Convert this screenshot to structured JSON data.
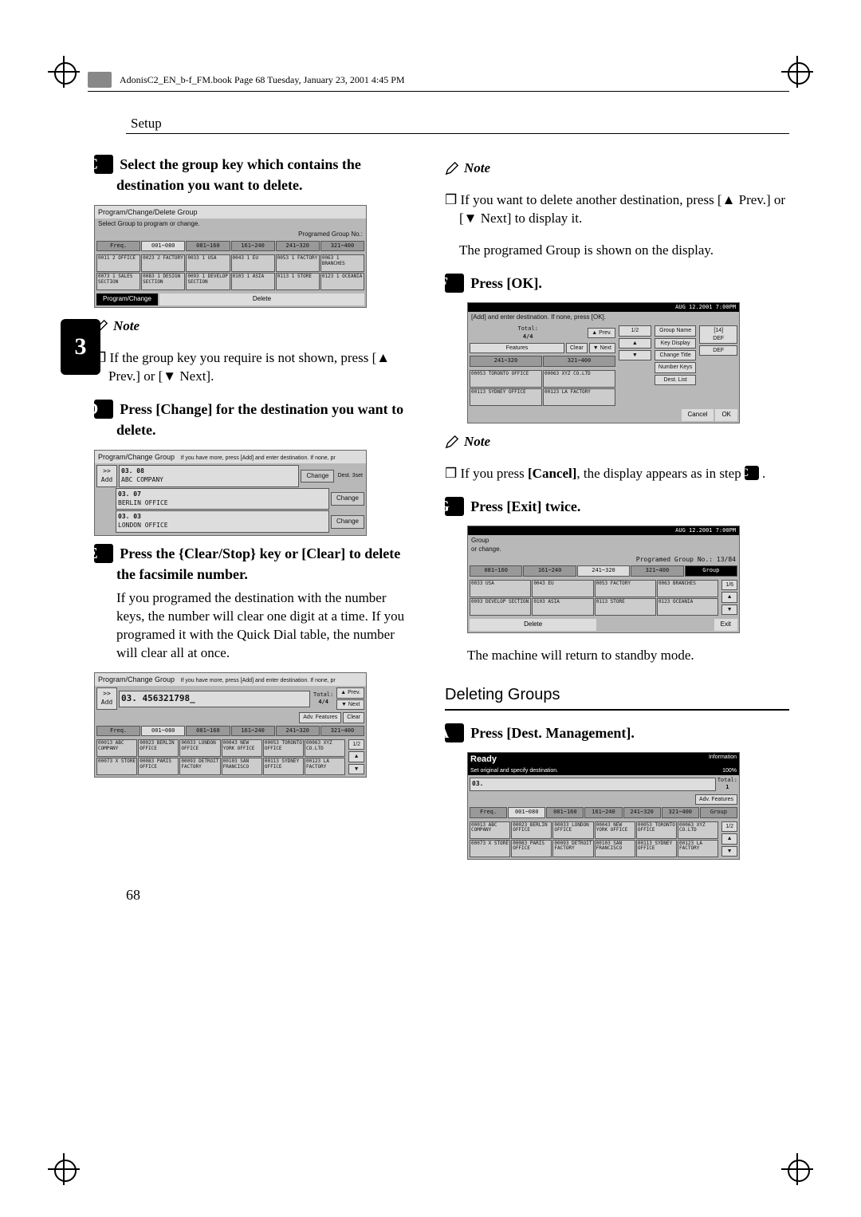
{
  "book_header": "AdonisC2_EN_b-f_FM.book  Page 68  Tuesday, January 23, 2001  4:45 PM",
  "section_header": "Setup",
  "side_tab": "3",
  "page_number": "68",
  "left": {
    "step3": {
      "num": "C",
      "text": "Select the group key which contains the destination you want to delete."
    },
    "lcd1": {
      "title": "Program/Change/Delete Group",
      "subtitle": "Select Group to program or change.",
      "group_no_label": "Programed Group No.:",
      "tabs": [
        "Freq.",
        "001~080",
        "081~160",
        "161~240",
        "241~320",
        "321~400"
      ],
      "cells_r1": [
        "0011 2\nOFFICE",
        "0023 2\nFACTORY",
        "0033 1\nUSA",
        "0043 1\nEU",
        "0053 1\nFACTORY",
        "0063 1\nBRANCHES"
      ],
      "cells_r2": [
        "0073 1\nSALES SECTION",
        "0083 1\nDESIGN SECTION",
        "0093 1\nDEVELOP SECTION",
        "0103 1\nASIA",
        "0113 1\nSTORE",
        "0123 1\nOCEANIA"
      ],
      "btn_program": "Program/Change",
      "btn_delete": "Delete"
    },
    "note1_head": "Note",
    "note1_body": "If the group key you require is not shown, press [▲ Prev.] or [▼ Next].",
    "step4": {
      "num": "D",
      "text_a": "Press ",
      "key": "[Change]",
      "text_b": " for the destination you want to delete."
    },
    "lcd2": {
      "title": "Program/Change Group",
      "hint": "If you have more, press [Add] and enter destination. If none, pr",
      "add": ">>\nAdd",
      "entries": [
        {
          "code": "03. 08",
          "name": "ABC COMPANY"
        },
        {
          "code": "03. 07",
          "name": "BERLIN OFFICE"
        },
        {
          "code": "03. 03",
          "name": "LONDON OFFICE"
        }
      ],
      "change": "Change",
      "dest_label": "Dest.\n3set"
    },
    "step5": {
      "num": "E",
      "text_a": "Press the ",
      "key": "{Clear/Stop}",
      "text_b": " key or ",
      "key2": "[Clear]",
      "text_c": " to delete the facsimile number."
    },
    "step5_body": "If you programed the destination with the number keys, the number will clear one digit at a time. If you programed it with the Quick Dial table, the number will clear all at once.",
    "lcd3": {
      "title": "Program/Change Group",
      "hint": "If you have more, press [Add] and enter destination. If none, pr",
      "add": ">>\nAdd",
      "entry_code": "03. 456321798_",
      "total_label": "Total:",
      "total": "4/4",
      "prev": "▲ Prev.",
      "next": "▼ Next",
      "adv": "Adv. Features",
      "clear": "Clear",
      "tabs": [
        "Freq.",
        "001~080",
        "081~160",
        "161~240",
        "241~320",
        "321~400"
      ],
      "cells_r1": [
        "00013\nABC COMPANY",
        "00023\nBERLIN OFFICE",
        "00033\nLONDON OFFICE",
        "00043\nNEW YORK OFFICE",
        "00053\nTORONTO OFFICE",
        "00063\nXYZ CO.LTD"
      ],
      "cells_r2": [
        "00073\nX STORE",
        "00083\nPARIS OFFICE",
        "00093\nDETROIT FACTORY",
        "00103\nSAN FRANCISCO",
        "00113\nSYDNEY OFFICE",
        "00123\nLA FACTORY"
      ],
      "page": "1/2"
    }
  },
  "right": {
    "note1_head": "Note",
    "note1_body": "If you want to delete another destination, press [▲ Prev.] or [▼ Next] to display it.",
    "note1_body2": "The programed Group is shown on the display.",
    "step6": {
      "num": "F",
      "text_a": "Press ",
      "key": "[OK]",
      "text_b": "."
    },
    "lcd4": {
      "timestamp": "AUG  12.2001  7:00PM",
      "hint": "[Add] and enter destination. If none, press [OK].",
      "total_label": "Total:",
      "total": "4/4",
      "prev": "▲ Prev.",
      "next": "▼ Next",
      "features": "Features",
      "clear": "Clear",
      "tabs": [
        "241~320",
        "321~400"
      ],
      "cells": [
        "00053\nTORONTO OFFICE",
        "00063\nXYZ CO.LTD",
        "00113\nSYDNEY OFFICE",
        "00123\nLA FACTORY"
      ],
      "page": "1/2",
      "side": [
        "Group Name",
        "Key Display",
        "Change Title",
        "Number Keys",
        "Dest. List"
      ],
      "code14": "[14]\nDEF",
      "def": "DEF",
      "cancel": "Cancel",
      "ok": "OK"
    },
    "note2_head": "Note",
    "note2_body_a": "If you press ",
    "note2_key": "[Cancel]",
    "note2_body_b": ", the display appears as in step ",
    "note2_ref": "C",
    "note2_body_c": ".",
    "step7": {
      "num": "G",
      "text_a": "Press ",
      "key": "[Exit]",
      "text_b": " twice."
    },
    "lcd5": {
      "timestamp": "AUG  12.2001  7:00PM",
      "title": "Group",
      "subtitle": "or change.",
      "group_no_label": "Programed Group No.:",
      "group_no": "13/84",
      "tabs": [
        "081~160",
        "161~240",
        "241~320",
        "321~400",
        "Group"
      ],
      "cells_r1": [
        "0033\nUSA",
        "0043\nEU",
        "0053\nFACTORY",
        "0063\nBRANCHES"
      ],
      "cells_r2": [
        "0093\nDEVELOP SECTION",
        "0103\nASIA",
        "0113\nSTORE",
        "0123\nOCEANIA"
      ],
      "page": "1/6",
      "delete": "Delete",
      "exit": "Exit"
    },
    "step7_body": "The machine will return to standby mode.",
    "h2": "Deleting Groups",
    "step1": {
      "num": "A",
      "text_a": "Press ",
      "key": "[Dest. Management]",
      "text_b": "."
    },
    "lcd6": {
      "ready": "Ready",
      "info_label": "Information",
      "set_original": "Set original and specify destination.",
      "pct": "100%",
      "code": "03.",
      "total_label": "Total:",
      "total": "1",
      "adv": "Adv. Features",
      "tabs": [
        "Freq.",
        "001~080",
        "081~160",
        "161~240",
        "241~320",
        "321~400",
        "Group"
      ],
      "cells_r1": [
        "00013\nABC COMPANY",
        "00023\nBERLIN OFFICE",
        "00033\nLONDON OFFICE",
        "00043\nNEW YORK OFFICE",
        "00053\nTORONTO OFFICE",
        "00063\nXYZ CO.LTD"
      ],
      "cells_r2": [
        "00073\nX STORE",
        "00083\nPARIS OFFICE",
        "00093\nDETROIT FACTORY",
        "00103\nSAN FRANCISCO",
        "00113\nSYDNEY OFFICE",
        "00123\nLA FACTORY"
      ],
      "page": "1/2"
    }
  }
}
